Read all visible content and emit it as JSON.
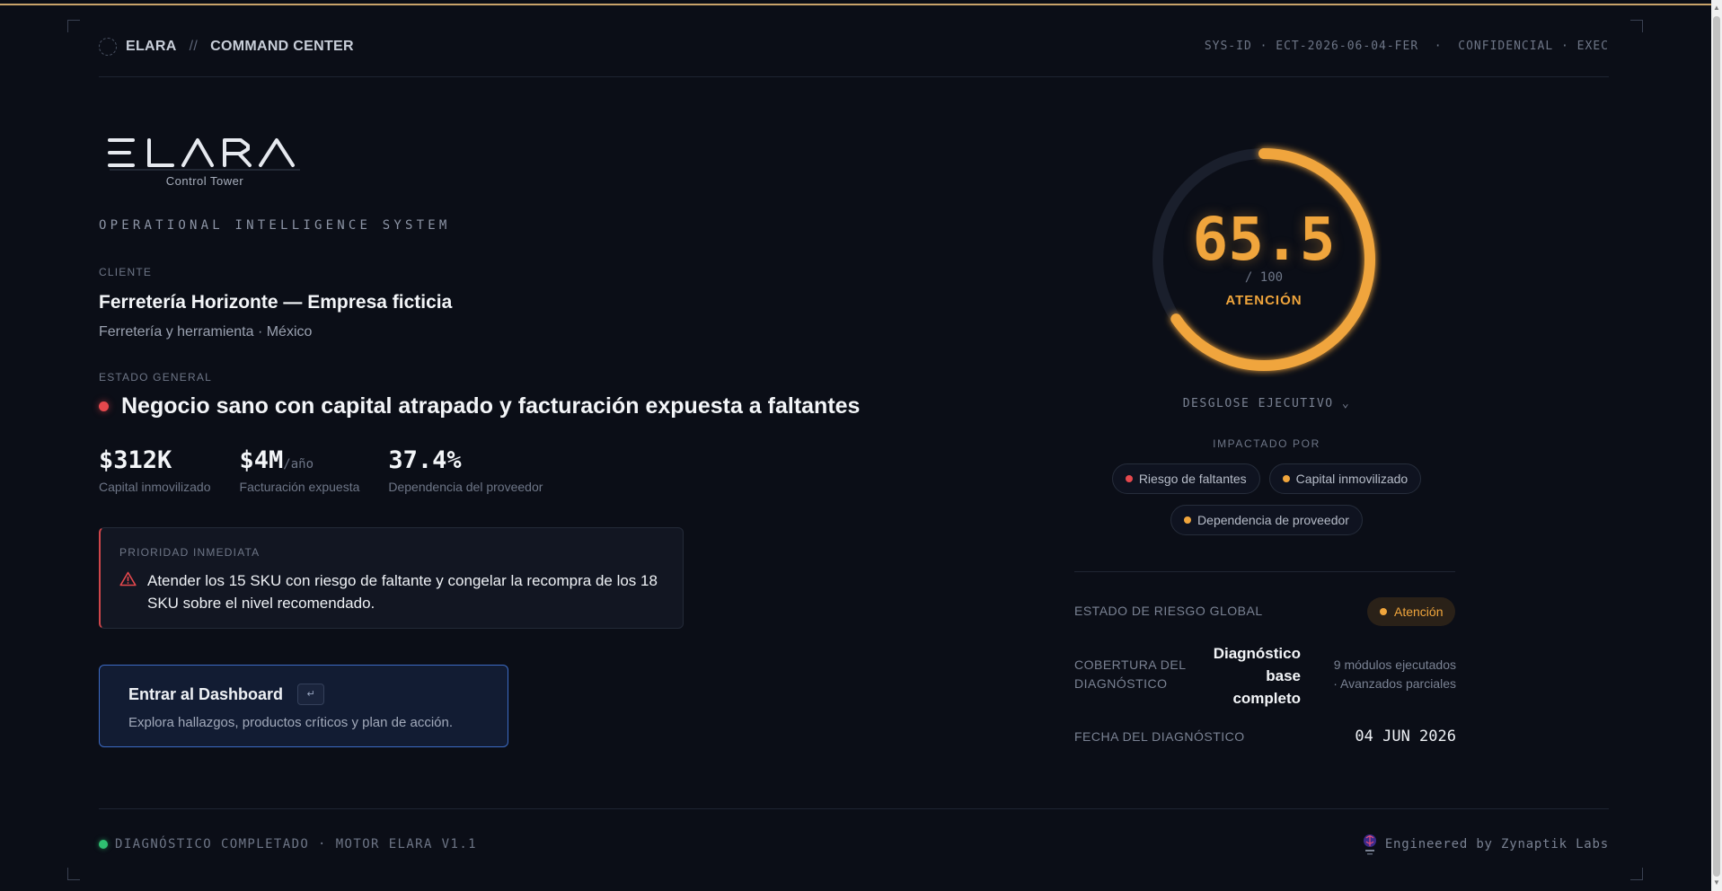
{
  "colors": {
    "accent": "#f0a53c",
    "danger": "#e5484d",
    "success": "#2fbf71",
    "primary_border": "#3c6bc4",
    "background": "#0b0e17"
  },
  "header": {
    "brand": "ELARA",
    "separator": "//",
    "section": "COMMAND CENTER",
    "meta": "SYS-ID · ECT-2026-06-04-FER  ·  CONFIDENCIAL · EXEC"
  },
  "logo": {
    "wordmark": "ELARA",
    "subtitle": "Control Tower"
  },
  "tagline": "OPERATIONAL INTELLIGENCE SYSTEM",
  "client": {
    "label": "CLIENTE",
    "name": "Ferretería Horizonte — Empresa ficticia",
    "subtitle": "Ferretería y herramienta · México"
  },
  "status": {
    "label": "ESTADO GENERAL",
    "text": "Negocio sano con capital atrapado y facturación expuesta a faltantes"
  },
  "kpis": [
    {
      "value": "$312K",
      "unit": "",
      "label": "Capital inmovilizado"
    },
    {
      "value": "$4M",
      "unit": "/año",
      "label": "Facturación expuesta"
    },
    {
      "value": "37.4%",
      "unit": "",
      "label": "Dependencia del proveedor"
    }
  ],
  "priority": {
    "label": "PRIORIDAD INMEDIATA",
    "text": "Atender los 15 SKU con riesgo de faltante y congelar la recompra de los 18 SKU sobre el nivel recomendado.",
    "icon": "warning-triangle-icon"
  },
  "cta": {
    "title": "Entrar al Dashboard",
    "key_hint": "↵",
    "subtitle": "Explora hallazgos, productos críticos y plan de acción."
  },
  "score": {
    "value": 65.5,
    "display": "65.5",
    "max_label": "/ 100",
    "max": 100,
    "state": "ATENCIÓN"
  },
  "breakdown": {
    "toggle_label": "DESGLOSE EJECUTIVO ⌄",
    "impacted_label": "IMPACTADO POR",
    "chips": [
      {
        "label": "Riesgo de faltantes",
        "color": "#e5484d"
      },
      {
        "label": "Capital inmovilizado",
        "color": "#f0a53c"
      },
      {
        "label": "Dependencia de proveedor",
        "color": "#f0a53c"
      }
    ]
  },
  "summary": {
    "risk": {
      "label": "ESTADO DE RIESGO GLOBAL",
      "badge": "Atención"
    },
    "coverage": {
      "label_line1": "COBERTURA DEL",
      "label_line2": "DIAGNÓSTICO",
      "value_line1": "Diagnóstico",
      "value_line2": "base",
      "value_line3": "completo",
      "note_line1": "9 módulos ejecutados",
      "note_line2": "· Avanzados parciales"
    },
    "date": {
      "label": "FECHA DEL DIAGNÓSTICO",
      "value": "04 JUN 2026"
    }
  },
  "footer": {
    "status": "DIAGNÓSTICO COMPLETADO · MOTOR ELARA V1.1",
    "credit": "Engineered by Zynaptik Labs"
  }
}
